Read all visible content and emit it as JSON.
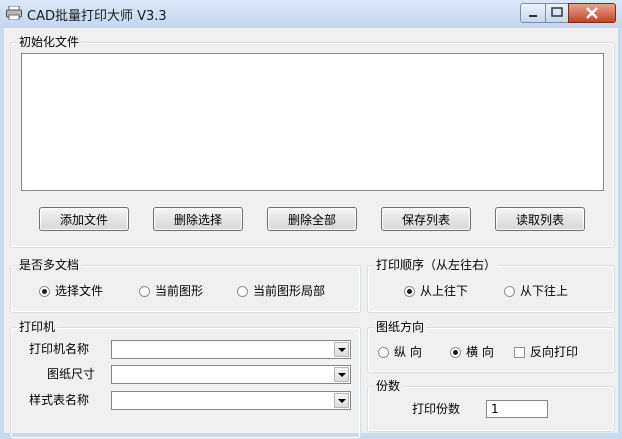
{
  "window": {
    "title": "CAD批量打印大师 V3.3",
    "icon": "printer-icon"
  },
  "init_files": {
    "title": "初始化文件",
    "buttons": {
      "add": "添加文件",
      "delete_selected": "删除选择",
      "delete_all": "删除全部",
      "save_list": "保存列表",
      "read_list": "读取列表"
    }
  },
  "multi_doc": {
    "title": "是否多文档",
    "options": [
      "选择文件",
      "当前图形",
      "当前图形局部"
    ],
    "selected": 0
  },
  "print_order": {
    "title": "打印顺序（从左往右）",
    "options": [
      "从上往下",
      "从下往上"
    ],
    "selected": 0
  },
  "printer": {
    "title": "打印机",
    "printer_name_label": "打印机名称",
    "paper_size_label": "图纸尺寸",
    "style_table_label": "样式表名称",
    "printer_name_value": "",
    "paper_size_value": "",
    "style_table_value": ""
  },
  "paper_orientation": {
    "title": "图纸方向",
    "options": [
      "纵 向",
      "横 向"
    ],
    "selected": 1,
    "reverse_label": "反向打印",
    "reverse_checked": false
  },
  "copies": {
    "title": "份数",
    "label": "打印份数",
    "value": "1"
  },
  "colors": {
    "title_bar": "#c9d9ee",
    "client_bg": "#f0f0f0",
    "close_button": "#c0442a"
  }
}
